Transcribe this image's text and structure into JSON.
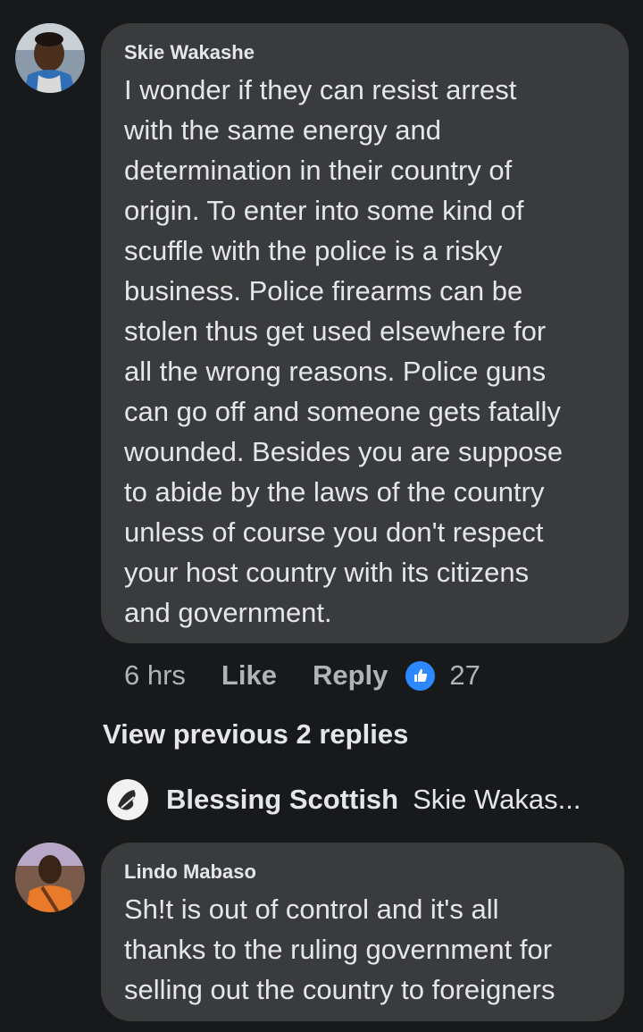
{
  "comments": [
    {
      "author": "Skie Wakashe",
      "lines": [
        "I wonder if they can resist arrest",
        "with the same energy and",
        "determination in their country of",
        "origin. To enter into some kind of",
        "scuffle with the police is a risky",
        "business. Police firearms can be",
        "stolen thus get used elsewhere for",
        "all the wrong reasons. Police guns",
        "can go off and someone gets fatally",
        "wounded. Besides you are suppose",
        "to abide by the laws of the country",
        "unless of course you don't respect",
        "your host country with its citizens",
        "and government."
      ],
      "time": "6 hrs",
      "like_label": "Like",
      "reply_label": "Reply",
      "reaction_icon": "like-thumbs-up",
      "reaction_count": "27"
    },
    {
      "author": "Lindo Mabaso",
      "lines": [
        "Sh!t is out of control and it's all",
        "thanks to the ruling government for",
        "selling out the country to foreigners"
      ]
    }
  ],
  "view_previous_label": "View previous 2 replies",
  "reply_preview": {
    "author": "Blessing Scottish",
    "snippet": "Skie Wakas..."
  },
  "colors": {
    "background": "#18191a",
    "bubble": "#3a3b3c",
    "text_primary": "#e4e6eb",
    "text_secondary": "#b0b3b8",
    "reaction_blue": "#2d88ff"
  }
}
